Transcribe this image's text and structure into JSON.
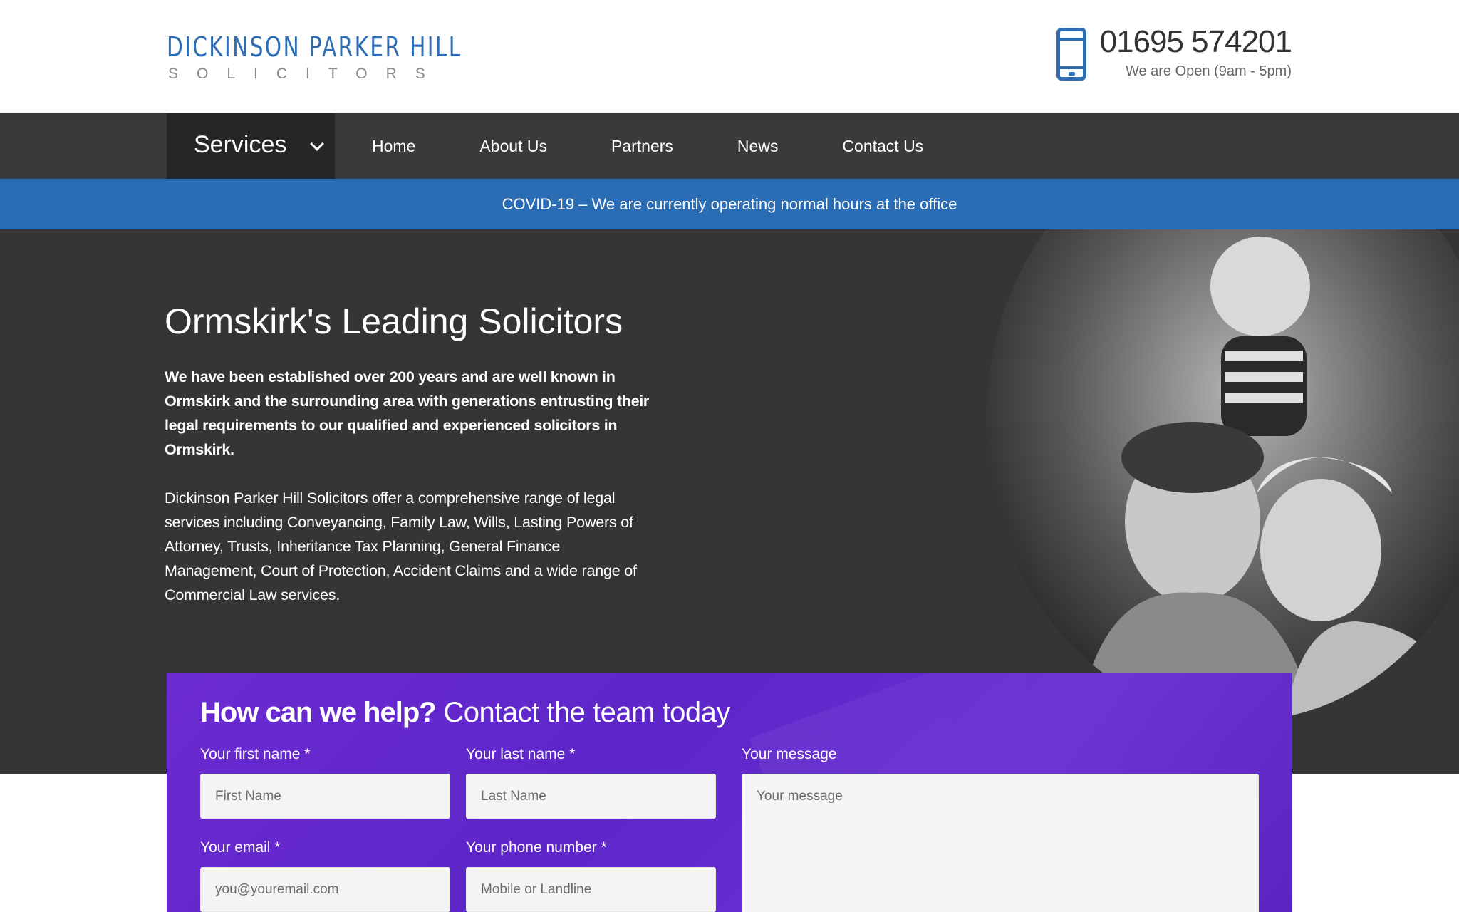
{
  "header": {
    "logo_top": "DICKINSON PARKER HILL",
    "logo_bottom": "SOLICITORS",
    "phone_number": "01695 574201",
    "opening_hours": "We are Open (9am - 5pm)"
  },
  "nav": {
    "services_label": "Services",
    "items": [
      "Home",
      "About Us",
      "Partners",
      "News",
      "Contact Us"
    ]
  },
  "notice": {
    "text": "COVID-19 – We are currently operating normal hours at the office"
  },
  "hero": {
    "title": "Ormskirk's Leading Solicitors",
    "lead": "We have been established over 200 years and are well known in Ormskirk and the surrounding area with generations entrusting their legal requirements to our qualified and experienced solicitors in Ormskirk.",
    "body": "Dickinson Parker Hill Solicitors offer a comprehensive range of legal services including Conveyancing, Family Law, Wills, Lasting Powers of Attorney, Trusts, Inheritance Tax Planning, General Finance Management, Court of Protection, Accident Claims and a wide range of Commercial Law services."
  },
  "form": {
    "heading_strong": "How can we help?",
    "heading_light": "Contact the team today",
    "first_name_label": "Your first name *",
    "first_name_placeholder": "First Name",
    "last_name_label": "Your last name *",
    "last_name_placeholder": "Last Name",
    "message_label": "Your message",
    "message_placeholder": "Your message",
    "email_label": "Your email *",
    "email_placeholder": "you@youremail.com",
    "phone_label": "Your phone number *",
    "phone_placeholder": "Mobile or Landline"
  },
  "colors": {
    "brand_blue": "#2a6db5",
    "nav_dark": "#3a3a3a",
    "hero_bg": "#353535",
    "form_purple": "#6229cc"
  }
}
